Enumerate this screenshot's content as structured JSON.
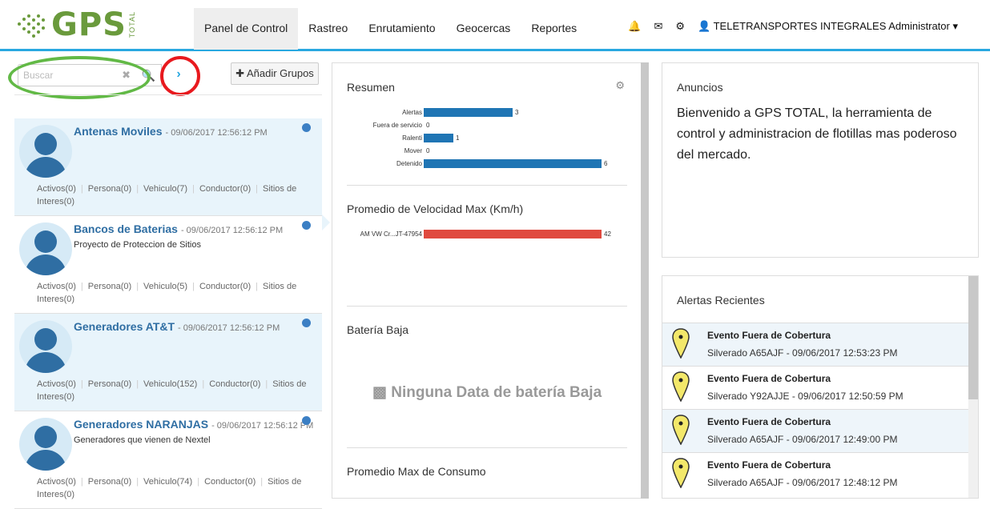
{
  "header": {
    "brand": "GPS",
    "brand_sub": "TOTAL",
    "nav": [
      "Panel de Control",
      "Rastreo",
      "Enrutamiento",
      "Geocercas",
      "Reportes"
    ],
    "active_nav": "Panel de Control",
    "icons": [
      "bell-icon",
      "envelope-icon",
      "gear-icon",
      "user-icon"
    ],
    "user_label": "TELETRANSPORTES INTEGRALES Administrator",
    "accent_color": "#29a8e0",
    "brand_color": "#6a9a3c"
  },
  "sidebar": {
    "search_placeholder": "Buscar",
    "add_groups_label": "Añadir Grupos",
    "groups": [
      {
        "name": "Antenas Moviles",
        "date": "- 09/06/2017 12:56:12 PM",
        "desc": "",
        "stats_line1": "Activos(0)",
        "persona": "Persona(0)",
        "vehiculo": "Vehiculo(7)",
        "conductor": "Conductor(0)",
        "sitios": "Sitios de Interes(0)"
      },
      {
        "name": "Bancos de Baterias",
        "date": "- 09/06/2017 12:56:12 PM",
        "desc": "Proyecto de Proteccion de Sitios",
        "stats_line1": "Activos(0)",
        "persona": "Persona(0)",
        "vehiculo": "Vehiculo(5)",
        "conductor": "Conductor(0)",
        "sitios": "Sitios de Interes(0)"
      },
      {
        "name": "Generadores AT&T",
        "date": "- 09/06/2017 12:56:12 PM",
        "desc": "",
        "stats_line1": "Activos(0)",
        "persona": "Persona(0)",
        "vehiculo": "Vehiculo(152)",
        "conductor": "Conductor(0)",
        "sitios": "Sitios de Interes(0)"
      },
      {
        "name": "Generadores NARANJAS",
        "date": "- 09/06/2017 12:56:12 PM",
        "desc": "Generadores que vienen de Nextel",
        "stats_line1": "Activos(0)",
        "persona": "Persona(0)",
        "vehiculo": "Vehiculo(74)",
        "conductor": "Conductor(0)",
        "sitios": "Sitios de Interes(0)"
      }
    ]
  },
  "middle": {
    "resumen_title": "Resumen",
    "resumen_bars": [
      {
        "label": "Alertas",
        "value": 3
      },
      {
        "label": "Fuera de servicio",
        "value": 0
      },
      {
        "label": "Ralenti",
        "value": 1
      },
      {
        "label": "Mover",
        "value": 0
      },
      {
        "label": "Detenido",
        "value": 6
      }
    ],
    "resumen_max": 6,
    "velocidad_title": "Promedio de Velocidad Max (Km/h)",
    "velocidad_bar": {
      "label": "AM VW Cr...JT-47954",
      "value": 42
    },
    "velocidad_max": 42,
    "bar_color_blue": "#1f75b4",
    "bar_color_red": "#e04a3f",
    "bateria_title": "Batería Baja",
    "bateria_empty": "Ninguna Data de batería Baja",
    "consumo_title": "Promedio Max de Consumo"
  },
  "announcements": {
    "title": "Anuncios",
    "text": "Bienvenido a GPS TOTAL, la herramienta de control y administracion de flotillas mas poderoso del mercado."
  },
  "alerts": {
    "title": "Alertas Recientes",
    "items": [
      {
        "title": "Evento Fuera de Cobertura",
        "sub": "Silverado A65AJF - 09/06/2017 12:53:23 PM"
      },
      {
        "title": "Evento Fuera de Cobertura",
        "sub": "Silverado Y92AJJE - 09/06/2017 12:50:59 PM"
      },
      {
        "title": "Evento Fuera de Cobertura",
        "sub": "Silverado A65AJF - 09/06/2017 12:49:00 PM"
      },
      {
        "title": "Evento Fuera de Cobertura",
        "sub": "Silverado A65AJF - 09/06/2017 12:48:12 PM"
      }
    ]
  }
}
